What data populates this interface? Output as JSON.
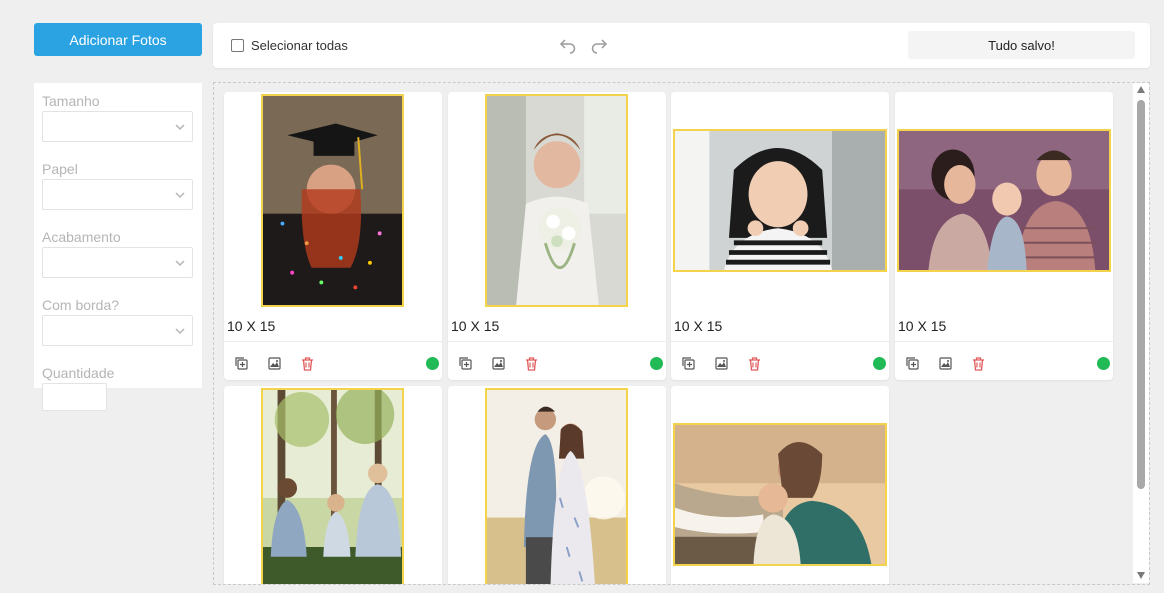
{
  "toolbar": {
    "add_photos_label": "Adicionar Fotos",
    "select_all_label": "Selecionar todas",
    "saved_status": "Tudo salvo!"
  },
  "sidebar": {
    "fields": [
      {
        "label": "Tamanho",
        "value": ""
      },
      {
        "label": "Papel",
        "value": ""
      },
      {
        "label": "Acabamento",
        "value": ""
      },
      {
        "label": "Com borda?",
        "value": ""
      }
    ],
    "quantity_label": "Quantidade",
    "quantity_value": ""
  },
  "photos": [
    {
      "size": "10 X 15",
      "subject": "graduate-blowing-confetti",
      "orientation": "portrait"
    },
    {
      "size": "10 X 15",
      "subject": "bride-with-bouquet",
      "orientation": "portrait"
    },
    {
      "size": "10 X 15",
      "subject": "girl-in-striped-sweater",
      "orientation": "landscape"
    },
    {
      "size": "10 X 15",
      "subject": "parents-kissing-baby",
      "orientation": "landscape"
    },
    {
      "size": "",
      "subject": "family-in-forest",
      "orientation": "portrait"
    },
    {
      "size": "",
      "subject": "couple-kissing-field",
      "orientation": "portrait"
    },
    {
      "size": "",
      "subject": "mother-and-son-at-beach",
      "orientation": "landscape"
    }
  ],
  "icons": {
    "duplicate": "duplicate-icon",
    "edit_image": "image-edit-icon",
    "delete": "trash-icon",
    "status": "status-ok-icon",
    "undo": "undo-icon",
    "redo": "redo-icon"
  },
  "colors": {
    "accent": "#2ba3e3",
    "photo_border": "#f2d34b",
    "delete": "#e05a5a",
    "status_ok": "#22b957"
  }
}
